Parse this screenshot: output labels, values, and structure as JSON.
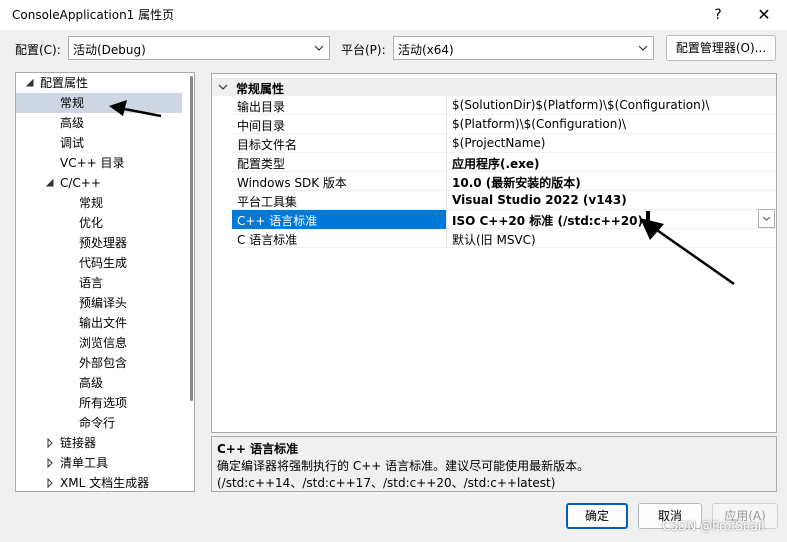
{
  "window": {
    "title": "ConsoleApplication1 属性页",
    "help": "?",
    "close": "✕"
  },
  "config_bar": {
    "config_label": "配置(C):",
    "config_value": "活动(Debug)",
    "platform_label": "平台(P):",
    "platform_value": "活动(x64)",
    "manager_button": "配置管理器(O)..."
  },
  "tree": {
    "items": [
      {
        "label": "配置属性",
        "expanded": true
      },
      {
        "label": "常规",
        "selected": true
      },
      {
        "label": "高级"
      },
      {
        "label": "调试"
      },
      {
        "label": "VC++ 目录"
      },
      {
        "label": "C/C++",
        "expanded": true
      },
      {
        "label": "常规"
      },
      {
        "label": "优化"
      },
      {
        "label": "预处理器"
      },
      {
        "label": "代码生成"
      },
      {
        "label": "语言"
      },
      {
        "label": "预编译头"
      },
      {
        "label": "输出文件"
      },
      {
        "label": "浏览信息"
      },
      {
        "label": "外部包含"
      },
      {
        "label": "高级"
      },
      {
        "label": "所有选项"
      },
      {
        "label": "命令行"
      },
      {
        "label": "链接器",
        "expanded": false
      },
      {
        "label": "清单工具",
        "expanded": false
      },
      {
        "label": "XML 文档生成器",
        "expanded": false
      }
    ]
  },
  "grid": {
    "category": "常规属性",
    "rows": [
      {
        "name": "输出目录",
        "value": "$(SolutionDir)$(Platform)\\$(Configuration)\\"
      },
      {
        "name": "中间目录",
        "value": "$(Platform)\\$(Configuration)\\"
      },
      {
        "name": "目标文件名",
        "value": "$(ProjectName)"
      },
      {
        "name": "配置类型",
        "value": "应用程序(.exe)"
      },
      {
        "name": "Windows SDK 版本",
        "value": "10.0 (最新安装的版本)"
      },
      {
        "name": "平台工具集",
        "value": "Visual Studio 2022 (v143)"
      },
      {
        "name": "C++ 语言标准",
        "value": "ISO C++20 标准 (/std:c++20)"
      },
      {
        "name": "C 语言标准",
        "value": "默认(旧 MSVC)"
      }
    ]
  },
  "description": {
    "title": "C++ 语言标准",
    "text": "确定编译器将强制执行的 C++ 语言标准。建议尽可能使用最新版本。(/std:c++14、/std:c++17、/std:c++20、/std:c++latest)"
  },
  "buttons": {
    "ok": "确定",
    "cancel": "取消",
    "apply": "应用(A)"
  },
  "watermark": "CSDN @ProfSnail",
  "colors": {
    "selection": "#0078d7",
    "tree_selection": "#cdd6e2",
    "primary_border": "#005fb8"
  }
}
